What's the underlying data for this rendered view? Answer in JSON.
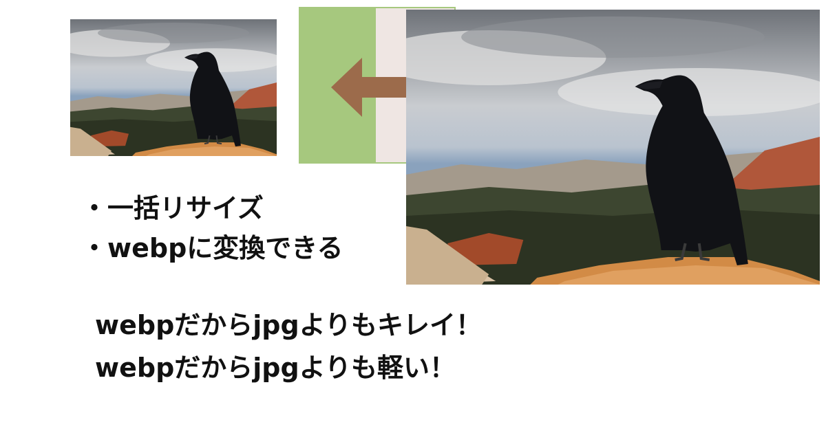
{
  "graphic": {
    "small_image": "raven-photo-small",
    "large_image": "raven-photo-large",
    "arrow_icon": "left-arrow-icon",
    "colors": {
      "green_panel": "#a6c87e",
      "light_panel": "#efe6e3",
      "arrow": "#9c6b4b"
    }
  },
  "features": [
    {
      "text": "・一括リサイズ"
    },
    {
      "text": "・webpに変換できる"
    }
  ],
  "taglines": [
    {
      "text": "webpだからjpgよりもキレイ！"
    },
    {
      "text": "webpだからjpgよりも軽い！"
    }
  ]
}
